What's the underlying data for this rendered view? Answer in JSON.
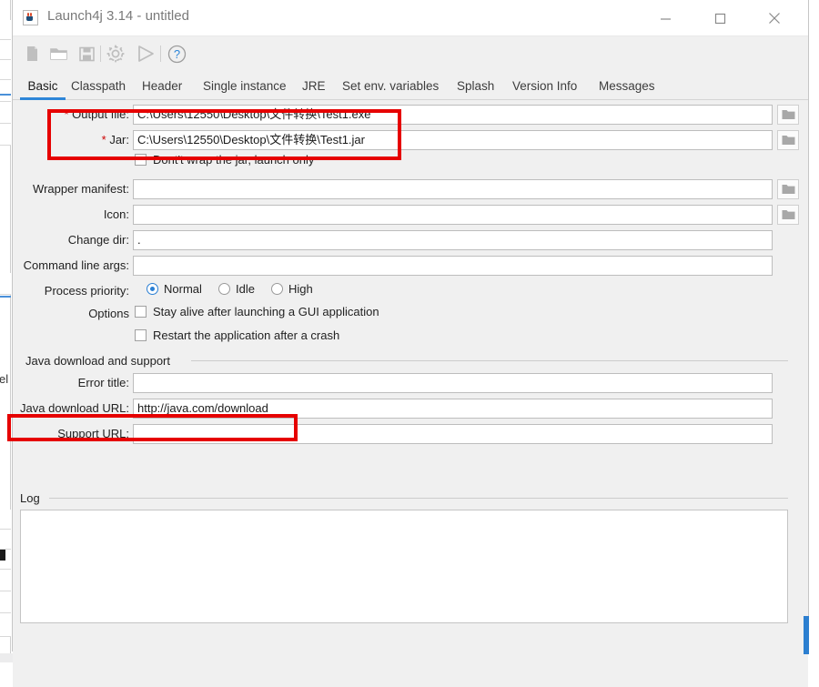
{
  "window": {
    "title": "Launch4j 3.14 - untitled",
    "icon": "java-cup-icon",
    "controls": {
      "minimize": "minimize-icon",
      "maximize": "maximize-icon",
      "close": "close-icon"
    }
  },
  "toolbar": {
    "items": [
      {
        "name": "new-file-icon",
        "title": "New"
      },
      {
        "name": "open-folder-icon",
        "title": "Open"
      },
      {
        "name": "save-disk-icon",
        "title": "Save"
      },
      {
        "name": "gear-icon",
        "title": "Build wrapper"
      },
      {
        "name": "play-icon",
        "title": "Test wrapper"
      },
      {
        "name": "help-question-icon",
        "title": "Help"
      }
    ]
  },
  "tabs": {
    "active": "Basic",
    "items": [
      {
        "label": "Basic"
      },
      {
        "label": "Classpath"
      },
      {
        "label": "Header"
      },
      {
        "label": "Single instance"
      },
      {
        "label": "JRE"
      },
      {
        "label": "Set env. variables"
      },
      {
        "label": "Splash"
      },
      {
        "label": "Version Info"
      },
      {
        "label": "Messages"
      }
    ]
  },
  "form": {
    "output_file": {
      "label": "Output file:",
      "required_mark": "*",
      "value": "C:\\Users\\12550\\Desktop\\文件转换\\Test1.exe",
      "browse": "folder-icon"
    },
    "jar": {
      "label": "Jar:",
      "required_mark": "*",
      "value": "C:\\Users\\12550\\Desktop\\文件转换\\Test1.jar",
      "browse": "folder-icon"
    },
    "dont_wrap": {
      "label": "Dont't wrap the jar, launch only",
      "checked": false
    },
    "wrapper_manifest": {
      "label": "Wrapper manifest:",
      "value": "",
      "browse": "folder-icon"
    },
    "icon": {
      "label": "Icon:",
      "value": "",
      "browse": "folder-icon"
    },
    "change_dir": {
      "label": "Change dir:",
      "value": "."
    },
    "command_line_args": {
      "label": "Command line args:",
      "value": ""
    },
    "process_priority": {
      "label": "Process priority:",
      "selected": "Normal",
      "options": [
        "Normal",
        "Idle",
        "High"
      ]
    },
    "options": {
      "label": "Options",
      "stay_alive": {
        "label": "Stay alive after launching a GUI application",
        "checked": false
      },
      "restart_on_crash": {
        "label": "Restart the application after a crash",
        "checked": false
      }
    }
  },
  "java_group": {
    "title": "Java download and support",
    "error_title": {
      "label": "Error title:",
      "value": ""
    },
    "java_download_url": {
      "label": "Java download URL:",
      "value": "http://java.com/download"
    },
    "support_url": {
      "label": "Support URL:",
      "value": ""
    }
  },
  "log_group": {
    "title": "Log",
    "content": ""
  },
  "annotations": [
    {
      "name": "output-file-and-jar-highlight",
      "color": "#e60000"
    },
    {
      "name": "java-download-url-highlight",
      "color": "#e60000"
    }
  ],
  "background": {
    "fragment_text": "el"
  },
  "colors": {
    "accent": "#2e86d8",
    "annotation": "#e60000",
    "window_bg": "#f0f0f0",
    "field_bg": "#ffffff",
    "required": "#cc0000"
  }
}
